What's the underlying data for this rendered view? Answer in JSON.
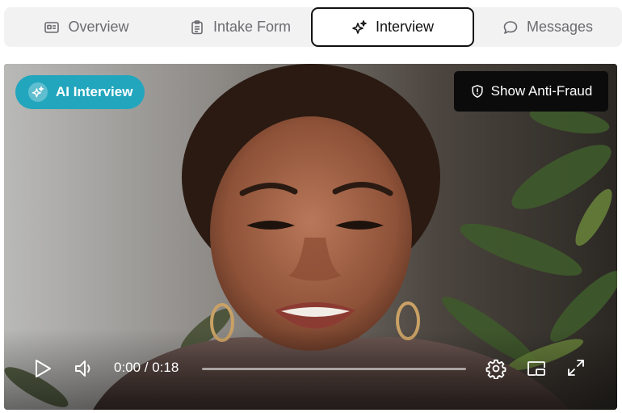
{
  "tabs": [
    {
      "label": "Overview",
      "icon": "id-card-icon",
      "active": false
    },
    {
      "label": "Intake Form",
      "icon": "clipboard-icon",
      "active": false
    },
    {
      "label": "Interview",
      "icon": "sparkles-icon",
      "active": true
    },
    {
      "label": "Messages",
      "icon": "chat-bubble-icon",
      "active": false
    }
  ],
  "video": {
    "badge_label": "AI Interview",
    "anti_fraud_label": "Show Anti-Fraud",
    "time_display": "0:00 / 0:18",
    "progress": 0,
    "badge_color": "#22a6bd"
  }
}
